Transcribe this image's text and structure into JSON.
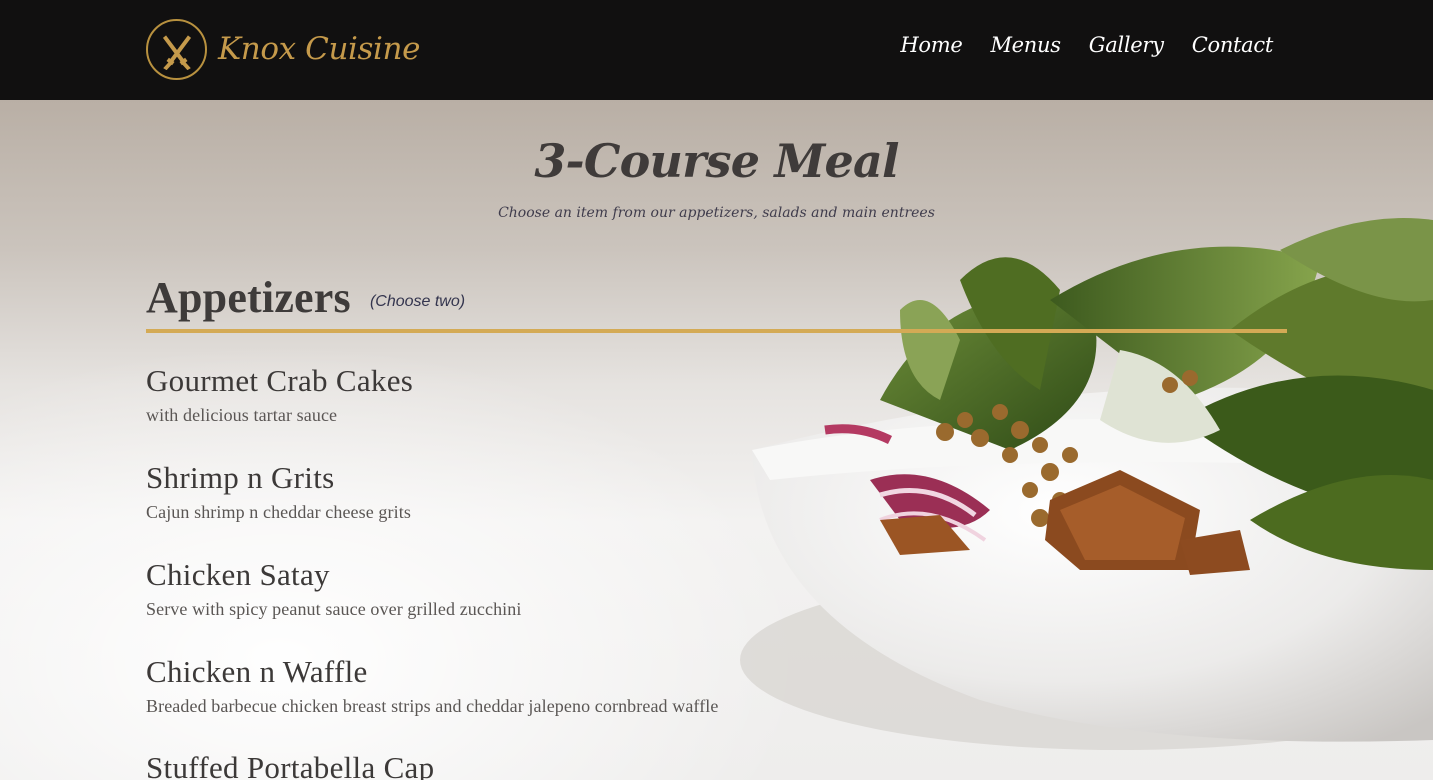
{
  "brand": {
    "name": "Knox Cuisine"
  },
  "nav": [
    {
      "label": "Home"
    },
    {
      "label": "Menus"
    },
    {
      "label": "Gallery"
    },
    {
      "label": "Contact"
    }
  ],
  "hero": {
    "title": "3-Course Meal",
    "subtitle": "Choose an item from our appetizers, salads and main entrees"
  },
  "section": {
    "title": "Appetizers",
    "note": "(Choose two)",
    "items": [
      {
        "name": "Gourmet Crab Cakes",
        "desc": "with delicious tartar sauce"
      },
      {
        "name": "Shrimp n Grits",
        "desc": "Cajun shrimp n cheddar cheese grits"
      },
      {
        "name": "Chicken Satay",
        "desc": "Serve with spicy peanut sauce over grilled zucchini"
      },
      {
        "name": "Chicken n Waffle",
        "desc": "Breaded barbecue chicken breast strips and cheddar jalepeno cornbread waffle"
      },
      {
        "name": "Stuffed Portabella Cap",
        "desc": ""
      }
    ]
  },
  "colors": {
    "header_bg": "#111010",
    "gold_accent": "#d4aa55",
    "logo_gold": "#c59a4b",
    "text_dark": "#3e3b3a"
  },
  "icons": {
    "logo": "crossed-knives-icon"
  }
}
